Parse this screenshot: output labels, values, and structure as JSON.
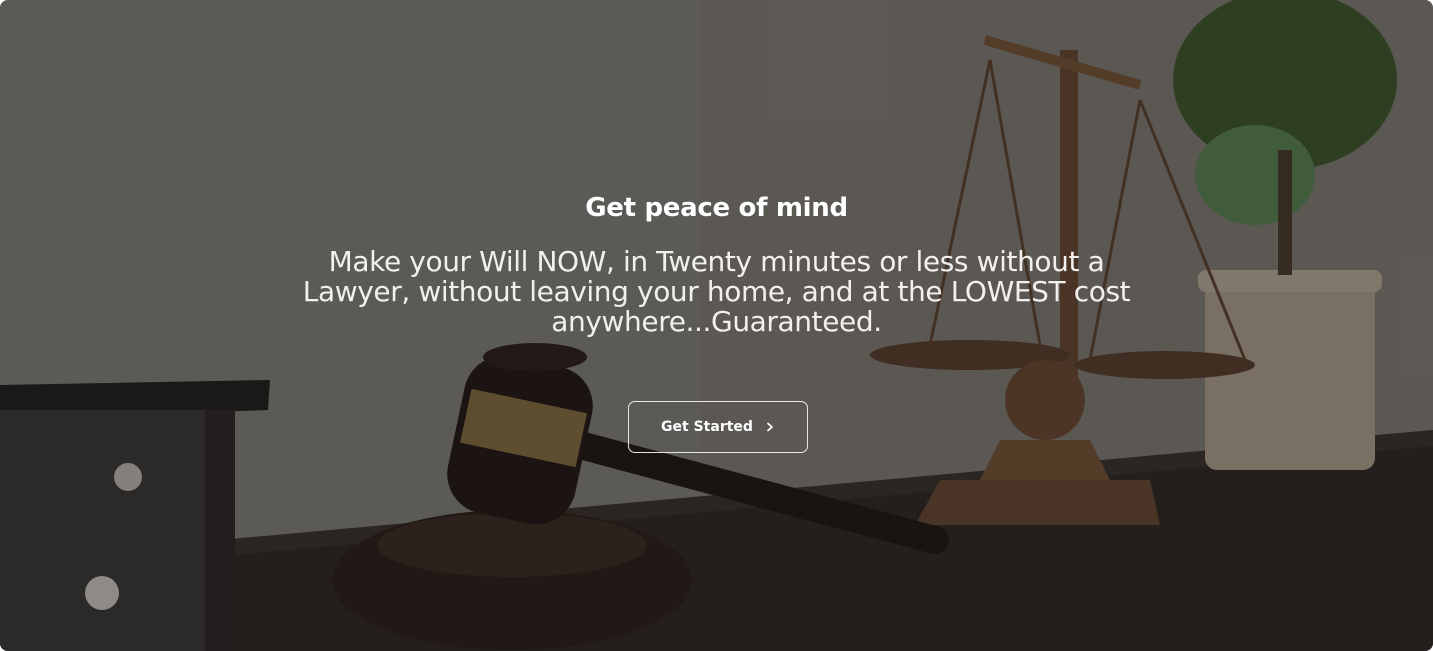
{
  "hero": {
    "headline": "Get peace of mind",
    "subline": "Make your Will NOW, in Twenty minutes or less without a Lawyer, without leaving your home, and at the LOWEST cost anywhere...Guaranteed.",
    "cta_label": "Get Started",
    "cta_icon": "chevron-right-icon",
    "background_image": "gavel-and-scales-of-justice-photo"
  },
  "colors": {
    "text": "#ffffff",
    "button_border": "#e8e6e3",
    "overlay": "#141211"
  }
}
